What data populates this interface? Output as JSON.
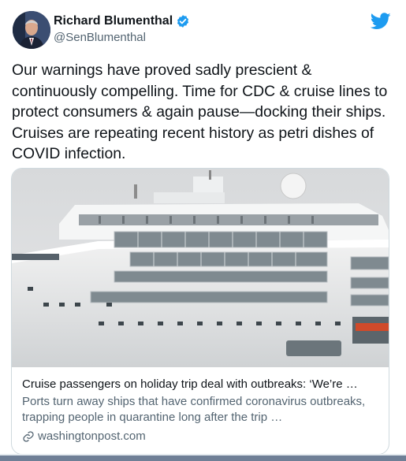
{
  "author": {
    "display_name": "Richard Blumenthal",
    "handle": "@SenBlumenthal",
    "verified": true
  },
  "tweet": {
    "text": "Our warnings have proved sadly prescient & continuously compelling. Time for CDC & cruise lines to protect consumers & again pause—docking their ships. Cruises are repeating recent history as petri dishes of COVID infection."
  },
  "card": {
    "image_alt": "cruise ship",
    "title": "Cruise passengers on holiday trip deal with outbreaks: ‘We’re …",
    "description": "Ports turn away ships that have confirmed coronavirus outbreaks, trapping people in quarantine long after the trip …",
    "domain": "washingtonpost.com"
  },
  "icons": {
    "verified": "verified-badge-icon",
    "brand": "twitter-bird-icon",
    "link": "link-icon"
  },
  "colors": {
    "brand": "#1d9bf0",
    "text": "#0f1419",
    "secondary": "#536471",
    "border": "#cfd9de"
  }
}
